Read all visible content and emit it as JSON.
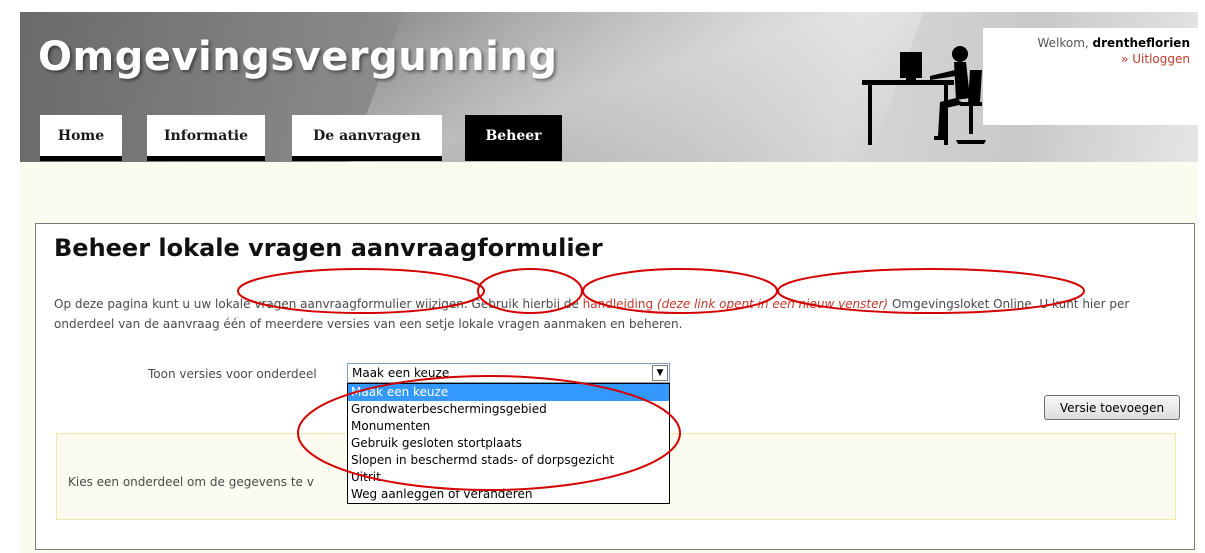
{
  "header": {
    "title": "Omgevingsvergunning",
    "welcome_prefix": "Welkom,",
    "username": "drentheflorien",
    "logout": "» Uitloggen"
  },
  "nav": {
    "tabs": [
      {
        "label": "Home",
        "active": false
      },
      {
        "label": "Informatie",
        "active": false
      },
      {
        "label": "De aanvragen",
        "active": false
      },
      {
        "label": "Beheer",
        "active": true
      }
    ]
  },
  "main": {
    "title": "Beheer lokale vragen aanvraagformulier",
    "intro_part1": "Op deze pagina kunt u uw lokale vragen aanvraagformulier wijzigen. Gebruik hierbij de ",
    "intro_link": "handleiding",
    "intro_link_note": "(deze link opent in een nieuw venster)",
    "intro_part2": " Omgevingsloket Online. U kunt hier per onderdeel van de aanvraag één of meerdere versies van een setje lokale vragen aanmaken en beheren.",
    "select_label": "Toon versies voor onderdeel",
    "select_value": "Maak een keuze",
    "options": [
      "Maak een keuze",
      "Grondwaterbeschermingsgebied",
      "Monumenten",
      "Gebruik gesloten stortplaats",
      "Slopen in beschermd stads- of dorpsgezicht",
      "Uitrit",
      "Weg aanleggen of veranderen"
    ],
    "add_version_button": "Versie toevoegen",
    "hint": "Kies een onderdeel om de gegevens te v"
  },
  "colors": {
    "link": "#c0392b",
    "annotation": "#d40000",
    "selected_option": "#3399ff",
    "page_background": "#fbfbef"
  }
}
